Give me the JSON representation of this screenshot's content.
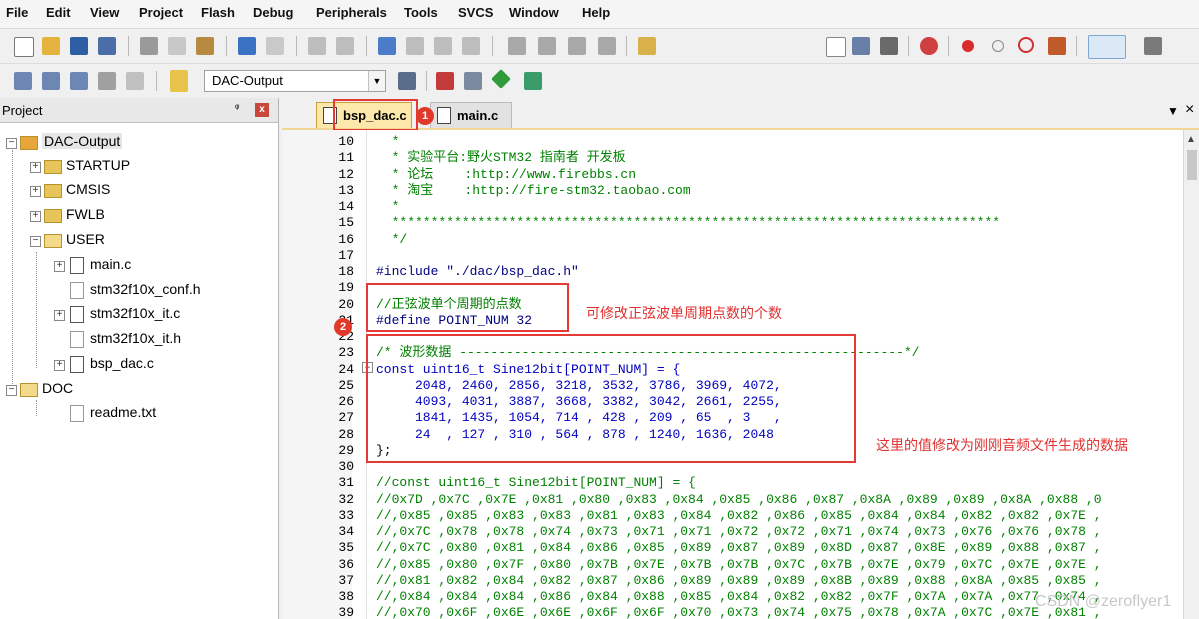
{
  "menu": [
    "File",
    "Edit",
    "View",
    "Project",
    "Flash",
    "Debug",
    "Peripherals",
    "Tools",
    "SVCS",
    "Window",
    "Help"
  ],
  "toolbar": {
    "target_combo": "DAC-Output",
    "icons": [
      "new-file-icon",
      "open-icon",
      "save-icon",
      "save-all-icon",
      "cut-icon",
      "copy-icon",
      "paste-icon",
      "undo-icon",
      "redo-icon",
      "nav-back-icon",
      "nav-forward-icon",
      "bookmark-icon",
      "prev-bookmark-icon",
      "next-bookmark-icon",
      "clear-bookmarks-icon",
      "indent-icon",
      "unindent-icon",
      "comment-icon",
      "uncomment-icon",
      "find-in-files-icon",
      "find-icon",
      "debug-session-icon",
      "breakpoint-icon",
      "disable-breakpoint-icon",
      "kill-breakpoints-icon",
      "view-icon",
      "config-icon",
      "translate-icon",
      "build-icon",
      "rebuild-icon",
      "batch-build-icon",
      "stop-build-icon",
      "download-icon",
      "target-options-icon",
      "manage-components-icon",
      "pack-installer-icon",
      "select-packs-icon"
    ]
  },
  "project": {
    "title": "Project",
    "pin": "ᵠ",
    "close": "x",
    "root": "DAC-Output",
    "groups": [
      "STARTUP",
      "CMSIS",
      "FWLB",
      "USER"
    ],
    "user_files": [
      "main.c",
      "stm32f10x_conf.h",
      "stm32f10x_it.c",
      "stm32f10x_it.h",
      "bsp_dac.c"
    ],
    "doc_group": "DOC",
    "doc_files": [
      "readme.txt"
    ]
  },
  "tabs": [
    {
      "label": "bsp_dac.c",
      "badge": "1"
    },
    {
      "label": "main.c"
    }
  ],
  "tab_controls": {
    "dropdown": "▼",
    "close": "×"
  },
  "code_lines": [
    {
      "n": "10",
      "t": "  *",
      "c": "g"
    },
    {
      "n": "11",
      "t": "  * 实验平台:野火STM32 指南者 开发板",
      "c": "g"
    },
    {
      "n": "12",
      "t": "  * 论坛    :http://www.firebbs.cn",
      "c": "g"
    },
    {
      "n": "13",
      "t": "  * 淘宝    :http://fire-stm32.taobao.com",
      "c": "g"
    },
    {
      "n": "14",
      "t": "  *",
      "c": "g"
    },
    {
      "n": "15",
      "t": "  ******************************************************************************",
      "c": "g"
    },
    {
      "n": "16",
      "t": "  */",
      "c": "g"
    },
    {
      "n": "17",
      "t": "",
      "c": ""
    },
    {
      "n": "18",
      "t": "#include \"./dac/bsp_dac.h\"",
      "c": "n"
    },
    {
      "n": "19",
      "t": "",
      "c": ""
    },
    {
      "n": "20",
      "t": "//正弦波单个周期的点数",
      "c": "g"
    },
    {
      "n": "21",
      "t": "#define POINT_NUM 32",
      "c": "n"
    },
    {
      "n": "22",
      "t": "",
      "c": ""
    },
    {
      "n": "23",
      "t": "/* 波形数据 ---------------------------------------------------------*/",
      "c": "g"
    },
    {
      "n": "24",
      "t": "const uint16_t Sine12bit[POINT_NUM] = {",
      "c": "b"
    },
    {
      "n": "25",
      "t": "     2048, 2460, 2856, 3218, 3532, 3786, 3969, 4072,",
      "c": "b"
    },
    {
      "n": "26",
      "t": "     4093, 4031, 3887, 3668, 3382, 3042, 2661, 2255,",
      "c": "b"
    },
    {
      "n": "27",
      "t": "     1841, 1435, 1054, 714 , 428 , 209 , 65  , 3   ,",
      "c": "b"
    },
    {
      "n": "28",
      "t": "     24  , 127 , 310 , 564 , 878 , 1240, 1636, 2048",
      "c": "b"
    },
    {
      "n": "29",
      "t": "};",
      "c": ""
    },
    {
      "n": "30",
      "t": "",
      "c": ""
    },
    {
      "n": "31",
      "t": "//const uint16_t Sine12bit[POINT_NUM] = {",
      "c": "g"
    },
    {
      "n": "32",
      "t": "//0x7D ,0x7C ,0x7E ,0x81 ,0x80 ,0x83 ,0x84 ,0x85 ,0x86 ,0x87 ,0x8A ,0x89 ,0x89 ,0x8A ,0x88 ,0",
      "c": "g"
    },
    {
      "n": "33",
      "t": "//,0x85 ,0x85 ,0x83 ,0x83 ,0x81 ,0x83 ,0x84 ,0x82 ,0x86 ,0x85 ,0x84 ,0x84 ,0x82 ,0x82 ,0x7E ,",
      "c": "g"
    },
    {
      "n": "34",
      "t": "//,0x7C ,0x78 ,0x78 ,0x74 ,0x73 ,0x71 ,0x71 ,0x72 ,0x72 ,0x71 ,0x74 ,0x73 ,0x76 ,0x76 ,0x78 ,",
      "c": "g"
    },
    {
      "n": "35",
      "t": "//,0x7C ,0x80 ,0x81 ,0x84 ,0x86 ,0x85 ,0x89 ,0x87 ,0x89 ,0x8D ,0x87 ,0x8E ,0x89 ,0x88 ,0x87 ,",
      "c": "g"
    },
    {
      "n": "36",
      "t": "//,0x85 ,0x80 ,0x7F ,0x80 ,0x7B ,0x7E ,0x7B ,0x7B ,0x7C ,0x7B ,0x7E ,0x79 ,0x7C ,0x7E ,0x7E ,",
      "c": "g"
    },
    {
      "n": "37",
      "t": "//,0x81 ,0x82 ,0x84 ,0x82 ,0x87 ,0x86 ,0x89 ,0x89 ,0x89 ,0x8B ,0x89 ,0x88 ,0x8A ,0x85 ,0x85 ,",
      "c": "g"
    },
    {
      "n": "38",
      "t": "//,0x84 ,0x84 ,0x84 ,0x86 ,0x84 ,0x88 ,0x85 ,0x84 ,0x82 ,0x82 ,0x7F ,0x7A ,0x7A ,0x77 ,0x74 ,",
      "c": "g"
    },
    {
      "n": "39",
      "t": "//,0x70 ,0x6F ,0x6E ,0x6E ,0x6F ,0x6F ,0x70 ,0x73 ,0x74 ,0x75 ,0x78 ,0x7A ,0x7C ,0x7E ,0x81 ,",
      "c": "g"
    }
  ],
  "annotations": {
    "note1": "可修改正弦波单周期点数的个数",
    "badge2": "2",
    "note2": "这里的值修改为刚刚音频文件生成的数据"
  },
  "watermark": "CSDN @zeroflyer1",
  "colors": {
    "annotation": "#e53935",
    "comment": "#008000",
    "keyword": "#0000c0"
  }
}
